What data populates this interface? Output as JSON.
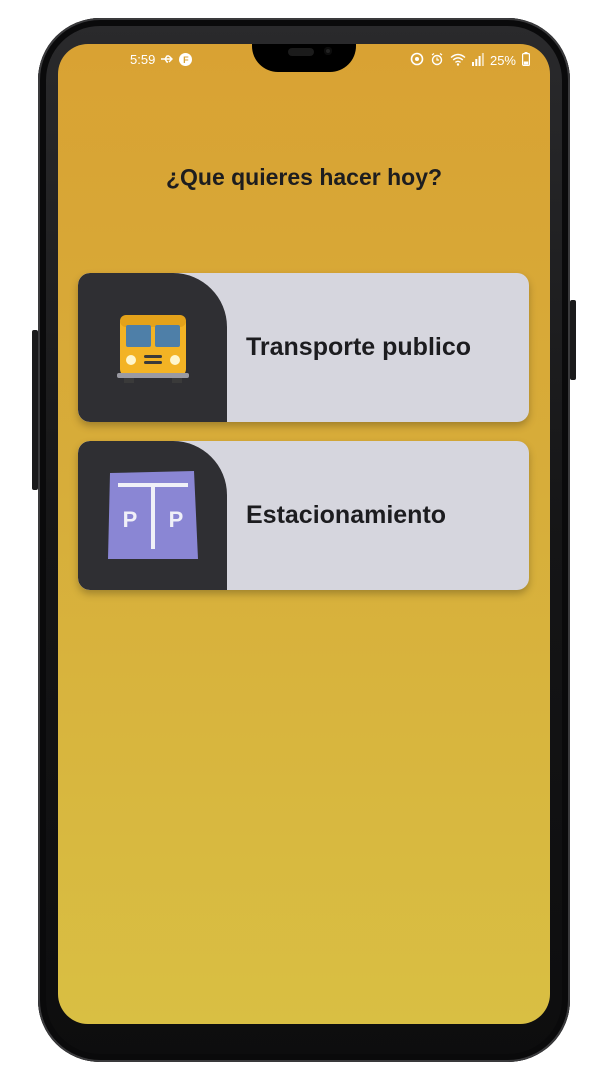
{
  "status_bar": {
    "time": "5:59",
    "battery": "25%",
    "left_icons": [
      "usb-icon",
      "app-notification-icon"
    ],
    "right_icons": [
      "data-saver-icon",
      "alarm-icon",
      "wifi-icon",
      "signal-icon",
      "battery-icon"
    ]
  },
  "screen": {
    "question": "¿Que quieres hacer hoy?"
  },
  "options": [
    {
      "label": "Transporte publico",
      "icon": "bus-icon"
    },
    {
      "label": "Estacionamiento",
      "icon": "parking-icon"
    }
  ],
  "parking_icon": {
    "left_letter": "P",
    "right_letter": "P"
  },
  "app_notification_badge": "F",
  "colors": {
    "background_top": "#d9a233",
    "background_bottom": "#d9bf43",
    "card": "#d6d6de",
    "icon_panel": "#2f2f33",
    "parking_sign": "#8a86d4",
    "bus_body": "#f3b324"
  }
}
